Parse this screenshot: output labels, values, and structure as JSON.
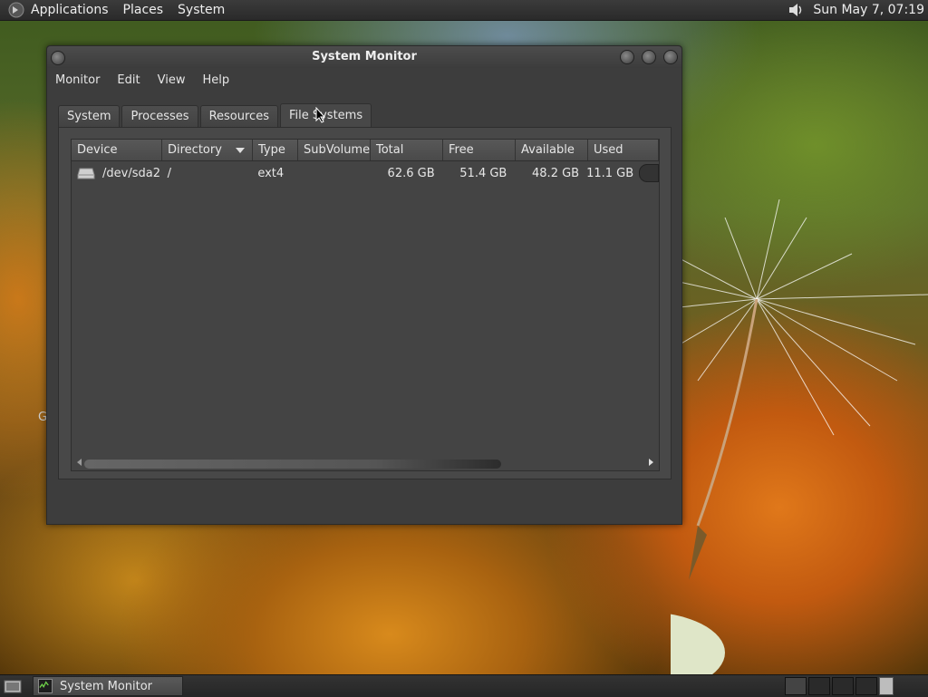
{
  "top_panel": {
    "menus": [
      "Applications",
      "Places",
      "System"
    ],
    "clock": "Sun May  7, 07:19",
    "icons": {
      "logo": "gnome-foot-icon",
      "volume": "speaker-icon"
    }
  },
  "desktop": {
    "trace_text": "G"
  },
  "window": {
    "title": "System Monitor",
    "menubar": [
      "Monitor",
      "Edit",
      "View",
      "Help"
    ],
    "tabs": [
      "System",
      "Processes",
      "Resources",
      "File Systems"
    ],
    "active_tab": "File Systems",
    "table": {
      "columns": [
        "Device",
        "Directory",
        "Type",
        "SubVolume",
        "Total",
        "Free",
        "Available",
        "Used"
      ],
      "sorted_column": "Directory",
      "rows": [
        {
          "device": "/dev/sda2",
          "directory": "/",
          "type": "ext4",
          "subvolume": "",
          "total": "62.6 GB",
          "free": "51.4 GB",
          "available": "48.2 GB",
          "used": "11.1 GB"
        }
      ]
    }
  },
  "bottom_panel": {
    "task": "System Monitor",
    "workspaces": 4,
    "active_workspace": 1
  }
}
